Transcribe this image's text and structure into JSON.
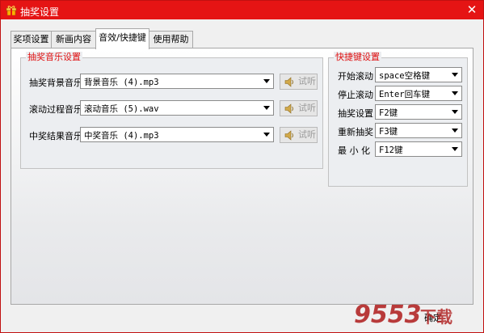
{
  "window": {
    "title": "抽奖设置",
    "close_glyph": "✕"
  },
  "tabs": [
    {
      "label": "奖项设置",
      "active": false
    },
    {
      "label": "新画内容",
      "active": false
    },
    {
      "label": "音效/快捷键",
      "active": true
    },
    {
      "label": "使用帮助",
      "active": false
    }
  ],
  "music_group": {
    "title": "抽奖音乐设置",
    "rows": [
      {
        "label": "抽奖背景音乐",
        "value": "背景音乐 (4).mp3",
        "button": "试听"
      },
      {
        "label": "滚动过程音乐",
        "value": "滚动音乐 (5).wav",
        "button": "试听"
      },
      {
        "label": "中奖结果音乐",
        "value": "中奖音乐 (4).mp3",
        "button": "试听"
      }
    ]
  },
  "hotkey_group": {
    "title": "快捷键设置",
    "rows": [
      {
        "label": "开始滚动",
        "value": "space空格键"
      },
      {
        "label": "停止滚动",
        "value": "Enter回车键"
      },
      {
        "label": "抽奖设置",
        "value": "F2键"
      },
      {
        "label": "重新抽奖",
        "value": "F3键"
      },
      {
        "label": "最 小 化",
        "value": "F12键"
      }
    ]
  },
  "footer": {
    "ok_label": "确定"
  },
  "watermark": {
    "text": "9553下载"
  },
  "icons": {
    "title": "gift-icon",
    "close": "close-icon",
    "speaker": "speaker-icon",
    "dropdown": "chevron-down-icon"
  },
  "colors": {
    "titlebar": "#e51414",
    "group_title": "#e01010",
    "watermark": "#b22727"
  }
}
